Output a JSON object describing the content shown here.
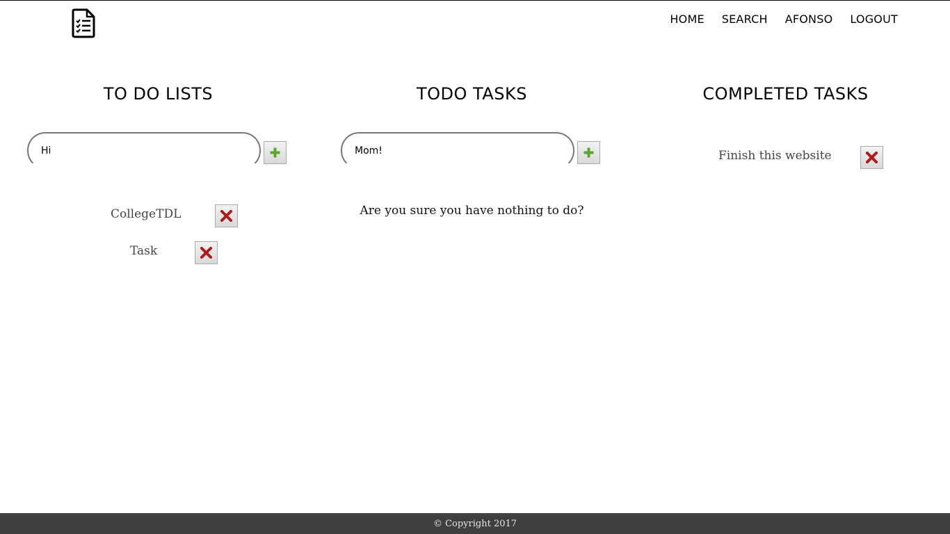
{
  "header": {
    "logo_icon": "checklist-document-icon",
    "nav": [
      {
        "label": "HOME"
      },
      {
        "label": "SEARCH"
      },
      {
        "label": "AFONSO"
      },
      {
        "label": "LOGOUT"
      }
    ]
  },
  "lists": {
    "title": "TO DO LISTS",
    "input_value": "Hi",
    "add_icon": "plus-icon",
    "items": [
      {
        "label": "CollegeTDL",
        "delete_icon": "delete-x-icon"
      },
      {
        "label": "Task",
        "delete_icon": "delete-x-icon"
      }
    ]
  },
  "todo": {
    "title": "TODO TASKS",
    "input_value": "Mom!",
    "add_icon": "plus-icon",
    "empty_message": "Are you sure you have nothing to do?"
  },
  "completed": {
    "title": "COMPLETED TASKS",
    "items": [
      {
        "label": "Finish this website",
        "delete_icon": "delete-x-icon"
      }
    ]
  },
  "footer": {
    "text": "© Copyright 2017"
  },
  "colors": {
    "plus": "#5aa832",
    "delete": "#b01a1a",
    "footer_bg": "#3f3f3f"
  }
}
